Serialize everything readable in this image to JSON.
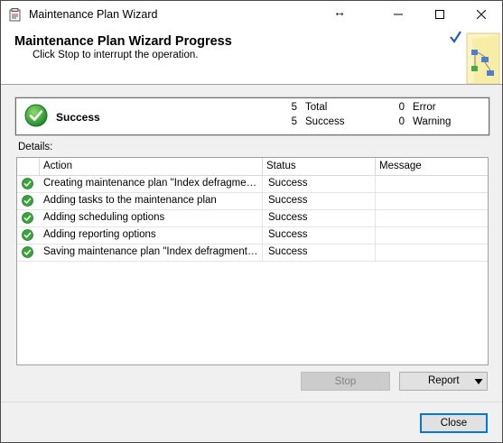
{
  "window": {
    "title": "Maintenance Plan Wizard",
    "resize_glyph": "↔"
  },
  "header": {
    "title": "Maintenance Plan Wizard Progress",
    "subtitle": "Click Stop to interrupt the operation."
  },
  "summary": {
    "status": "Success",
    "total_count": "5",
    "total_label": "Total",
    "success_count": "5",
    "success_label": "Success",
    "error_count": "0",
    "error_label": "Error",
    "warning_count": "0",
    "warning_label": "Warning",
    "icon": "success-check-icon"
  },
  "details": {
    "label": "Details:",
    "columns": [
      "Action",
      "Status",
      "Message"
    ],
    "rows": [
      {
        "action": "Creating maintenance plan \"Index defragmentation\"",
        "status": "Success",
        "message": ""
      },
      {
        "action": "Adding tasks to the maintenance plan",
        "status": "Success",
        "message": ""
      },
      {
        "action": "Adding scheduling options",
        "status": "Success",
        "message": ""
      },
      {
        "action": "Adding reporting options",
        "status": "Success",
        "message": ""
      },
      {
        "action": "Saving maintenance plan \"Index defragmentation\"",
        "status": "Success",
        "message": ""
      }
    ]
  },
  "buttons": {
    "stop": "Stop",
    "report": "Report",
    "close": "Close"
  },
  "colors": {
    "success_green": "#3aa33a",
    "focus_blue": "#0078d7"
  }
}
